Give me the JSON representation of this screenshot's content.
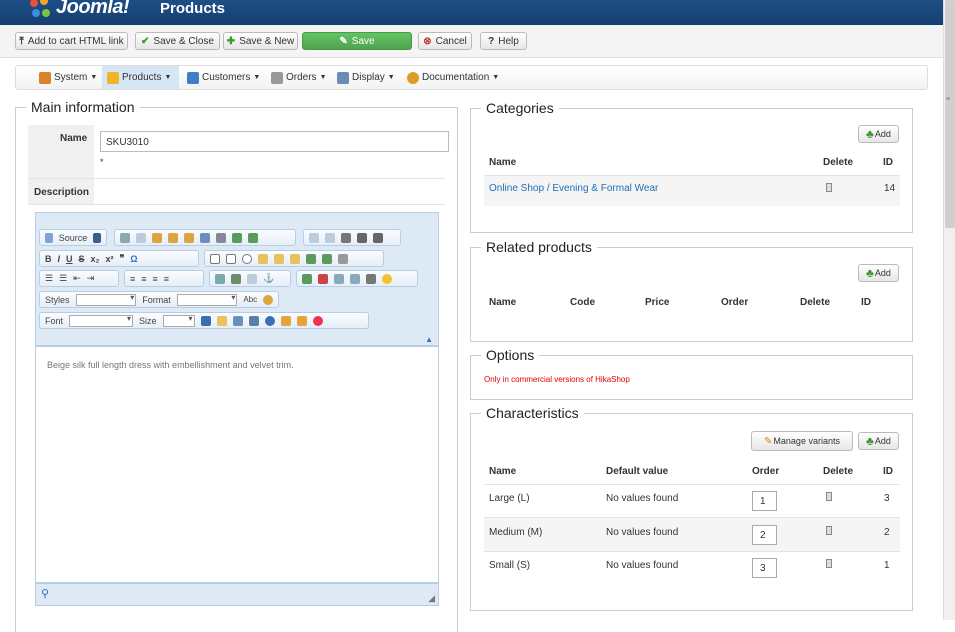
{
  "header": {
    "logo_text": "Joomla!",
    "title": "Products"
  },
  "toolbar": {
    "add_to_cart": "Add to cart HTML link",
    "save_close": "Save & Close",
    "save_new": "Save & New",
    "save": "Save",
    "cancel": "Cancel",
    "help": "Help"
  },
  "menu": [
    {
      "label": "System",
      "color": "#d9822b"
    },
    {
      "label": "Products",
      "color": "#f0b429"
    },
    {
      "label": "Customers",
      "color": "#3d7ec7"
    },
    {
      "label": "Orders",
      "color": "#999999"
    },
    {
      "label": "Display",
      "color": "#6b8db5"
    },
    {
      "label": "Documentation",
      "color": "#e09a2a"
    }
  ],
  "main_info": {
    "legend": "Main information",
    "name_label": "Name",
    "name_value": "SKU3010",
    "required_mark": "*",
    "description_label": "Description",
    "description_text": "Beige silk full length dress with embellishment and velvet trim."
  },
  "editor": {
    "source_label": "Source",
    "styles_label": "Styles",
    "format_label": "Format",
    "font_label": "Font",
    "size_label": "Size"
  },
  "categories": {
    "legend": "Categories",
    "add_label": "Add",
    "headers": {
      "name": "Name",
      "delete": "Delete",
      "id": "ID"
    },
    "rows": [
      {
        "name": "Online Shop / Evening & Formal Wear",
        "id": "14"
      }
    ]
  },
  "related": {
    "legend": "Related products",
    "add_label": "Add",
    "headers": [
      "Name",
      "Code",
      "Price",
      "Order",
      "Delete",
      "ID"
    ]
  },
  "options": {
    "legend": "Options",
    "note": "Only in commercial versions of HikaShop"
  },
  "characteristics": {
    "legend": "Characteristics",
    "manage_label": "Manage variants",
    "add_label": "Add",
    "headers": {
      "name": "Name",
      "default": "Default value",
      "order": "Order",
      "delete": "Delete",
      "id": "ID"
    },
    "rows": [
      {
        "name": "Large (L)",
        "default": "No values found",
        "order": "1",
        "id": "3"
      },
      {
        "name": "Medium (M)",
        "default": "No values found",
        "order": "2",
        "id": "2"
      },
      {
        "name": "Small (S)",
        "default": "No values found",
        "order": "3",
        "id": "1"
      }
    ]
  },
  "colors": {
    "header_bg": "#1a4a80",
    "save_green": "#51a351",
    "link_blue": "#1f6fb5",
    "note_red": "#e00000"
  }
}
